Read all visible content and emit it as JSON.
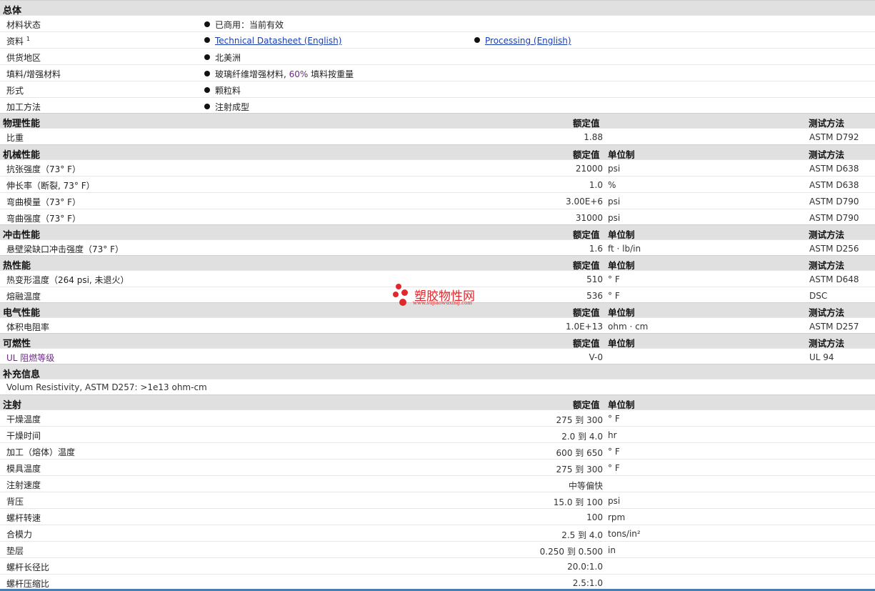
{
  "general": {
    "title": "总体",
    "rows": [
      {
        "label": "材料状态",
        "value": "已商用：当前有效"
      },
      {
        "label": "资料",
        "sup": "1",
        "link1": "Technical Datasheet (English)",
        "link2": "Processing (English)"
      },
      {
        "label": "供货地区",
        "value": "北美洲"
      },
      {
        "label": "填料/增强材料",
        "value_a": "玻璃纤维增强材料, ",
        "value_b": "60%",
        "value_c": " 填料按重量"
      },
      {
        "label": "形式",
        "value": "颗粒料"
      },
      {
        "label": "加工方法",
        "value": "注射成型"
      }
    ]
  },
  "headers": {
    "rated": "额定值",
    "unit": "单位制",
    "method": "测试方法"
  },
  "physical": {
    "title": "物理性能",
    "rows": [
      {
        "label": "比重",
        "value": "1.88",
        "unit": "",
        "method": "ASTM D792"
      }
    ]
  },
  "mechanical": {
    "title": "机械性能",
    "rows": [
      {
        "label": "抗张强度（73° F）",
        "value": "21000",
        "unit": "psi",
        "method": "ASTM D638"
      },
      {
        "label": "伸长率（断裂, 73° F）",
        "value": "1.0",
        "unit": "%",
        "method": "ASTM D638"
      },
      {
        "label": "弯曲模量（73° F）",
        "value": "3.00E+6",
        "unit": "psi",
        "method": "ASTM D790"
      },
      {
        "label": "弯曲强度（73° F）",
        "value": "31000",
        "unit": "psi",
        "method": "ASTM D790"
      }
    ]
  },
  "impact": {
    "title": "冲击性能",
    "rows": [
      {
        "label": "悬壁梁缺口冲击强度（73° F）",
        "value": "1.6",
        "unit": "ft · lb/in",
        "method": "ASTM D256"
      }
    ]
  },
  "thermal": {
    "title": "热性能",
    "rows": [
      {
        "label": "热变形温度（264 psi, 未退火）",
        "value": "510",
        "unit": "° F",
        "method": "ASTM D648"
      },
      {
        "label": "熔融温度",
        "value": "536",
        "unit": "° F",
        "method": "DSC"
      }
    ]
  },
  "electrical": {
    "title": "电气性能",
    "rows": [
      {
        "label": "体积电阻率",
        "value": "1.0E+13",
        "unit": "ohm · cm",
        "method": "ASTM D257"
      }
    ]
  },
  "flammability": {
    "title": "可燃性",
    "rows": [
      {
        "label": "UL 阻燃等级",
        "value": "V-0",
        "unit": "",
        "method": "UL 94"
      }
    ]
  },
  "supplement": {
    "title": "补充信息",
    "note": "Volum Resistivity, ASTM D257: >1e13 ohm-cm"
  },
  "injection": {
    "title": "注射",
    "rows": [
      {
        "label": "干燥温度",
        "value": "275 到  300",
        "unit": "° F"
      },
      {
        "label": "干燥时间",
        "value": "2.0 到  4.0",
        "unit": "hr"
      },
      {
        "label": "加工（熔体）温度",
        "value": "600 到  650",
        "unit": "° F"
      },
      {
        "label": "模具温度",
        "value": "275 到  300",
        "unit": "° F"
      },
      {
        "label": "注射速度",
        "value": "中等偏快",
        "unit": ""
      },
      {
        "label": "背压",
        "value": "15.0 到  100",
        "unit": "psi"
      },
      {
        "label": "螺杆转速",
        "value": "100",
        "unit": "rpm"
      },
      {
        "label": "合模力",
        "value": "2.5 到  4.0",
        "unit": "tons/in²"
      },
      {
        "label": "垫层",
        "value": "0.250 到  0.500",
        "unit": "in"
      },
      {
        "label": "螺杆长径比",
        "value": "20.0:1.0",
        "unit": ""
      },
      {
        "label": "螺杆压缩比",
        "value": "2.5:1.0",
        "unit": ""
      }
    ]
  },
  "watermark": {
    "name": "塑胶物性网",
    "url": "www.sujiaowuxing.com"
  }
}
